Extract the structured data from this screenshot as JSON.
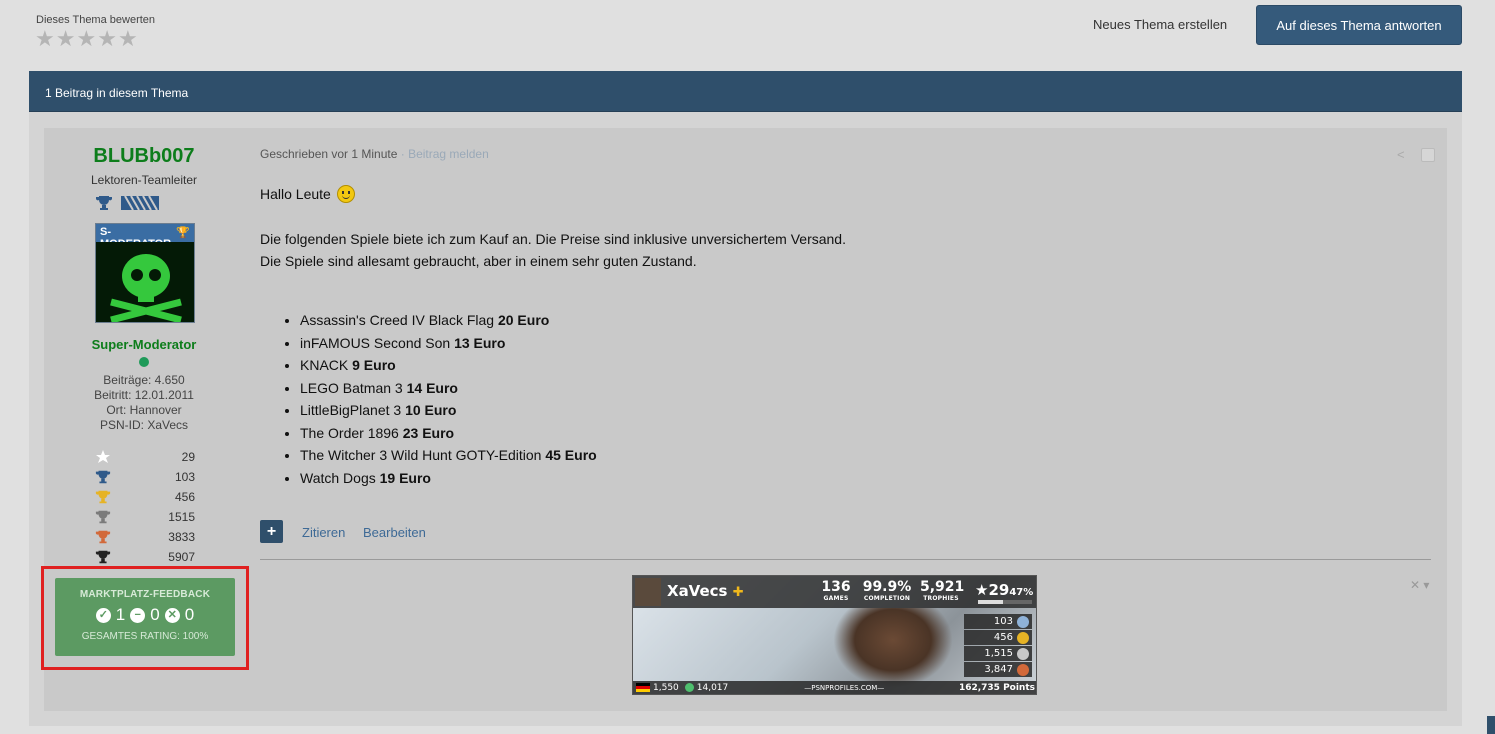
{
  "rating": {
    "label": "Dieses Thema bewerten",
    "stars": [
      "★",
      "★",
      "★",
      "★",
      "★"
    ]
  },
  "header": {
    "new_topic": "Neues Thema erstellen",
    "reply": "Auf dieses Thema antworten"
  },
  "topic_bar": {
    "count_text": "1 Beitrag in diesem Thema"
  },
  "author": {
    "name": "BLUBb007",
    "title": "Lektoren-Teamleiter",
    "avatar_label": "S-MODERATOR",
    "group": "Super-Moderator",
    "stats": [
      "Beiträge: 4.650",
      "Beitritt: 12.01.2011",
      "Ort: Hannover",
      "PSN-ID: XaVecs"
    ],
    "trophies": [
      {
        "icon": "star-icon",
        "color": "#ffffff",
        "value": "29"
      },
      {
        "icon": "trophy-icon",
        "color": "#2f5a8a",
        "value": "103"
      },
      {
        "icon": "trophy-icon",
        "color": "#e6b325",
        "value": "456"
      },
      {
        "icon": "trophy-icon",
        "color": "#7b7b7b",
        "value": "1515"
      },
      {
        "icon": "trophy-icon",
        "color": "#d2693a",
        "value": "3833"
      },
      {
        "icon": "trophy-icon",
        "color": "#222222",
        "value": "5907"
      }
    ]
  },
  "feedback": {
    "title": "MARKTPLATZ-FEEDBACK",
    "positive": "1",
    "neutral": "0",
    "negative": "0",
    "rating": "GESAMTES RATING: 100%"
  },
  "post": {
    "meta": "Geschrieben vor 1 Minute",
    "report": " · Beitrag melden",
    "greeting": "Hallo Leute",
    "intro_line1": "Die folgenden Spiele biete ich zum Kauf an. Die Preise sind inklusive unversichertem Versand.",
    "intro_line2": "Die Spiele sind allesamt gebraucht, aber in einem sehr guten Zustand.",
    "games": [
      {
        "name": "Assassin's Creed IV Black Flag ",
        "price": "20 Euro"
      },
      {
        "name": "inFAMOUS Second Son ",
        "price": "13 Euro"
      },
      {
        "name": "KNACK ",
        "price": "9 Euro"
      },
      {
        "name": "LEGO Batman 3 ",
        "price": "14 Euro"
      },
      {
        "name": "LittleBigPlanet 3 ",
        "price": "10 Euro"
      },
      {
        "name": "The Order 1896 ",
        "price": "23 Euro"
      },
      {
        "name": "The Witcher 3 Wild Hunt GOTY-Edition ",
        "price": "45 Euro"
      },
      {
        "name": "Watch Dogs ",
        "price": "19 Euro"
      }
    ],
    "actions": {
      "plus": "+",
      "quote": "Zitieren",
      "edit": "Bearbeiten"
    }
  },
  "banner": {
    "name": "XaVecs",
    "games": "136",
    "games_label": "GAMES",
    "completion": "99.9%",
    "completion_label": "COMPLETION",
    "trophies": "5,921",
    "trophies_label": "TROPHIES",
    "level": "29",
    "level_pct": "47%",
    "level_progress": 0.47,
    "platinum": "103",
    "gold": "456",
    "silver": "1,515",
    "bronze": "3,847",
    "rank_country": "1,550",
    "rank_world": "14,017",
    "site": "—PSNPROFILES.COM—",
    "points": "162,735 Points"
  }
}
